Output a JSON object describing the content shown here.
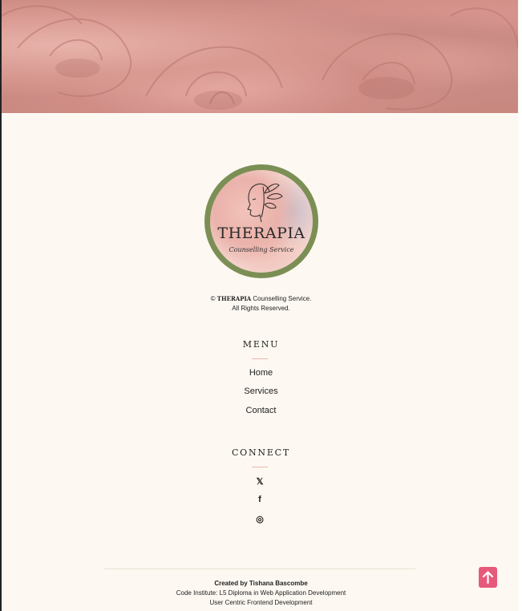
{
  "hero": {
    "image": "pink-roses-banner"
  },
  "logo": {
    "title": "THERAPIA",
    "subtitle": "Counselling Service",
    "ring_color": "#7b8f55"
  },
  "footer": {
    "copyright_symbol": "©",
    "brand": "THERAPIA",
    "copyright_text": "Counselling Service.",
    "rights": "All Rights Reserved.",
    "menu_heading": "MENU",
    "menu_items": [
      "Home",
      "Services",
      "Contact"
    ],
    "connect_heading": "CONNECT",
    "social": [
      {
        "name": "x-twitter-icon",
        "glyph": "𝕏"
      },
      {
        "name": "facebook-icon",
        "glyph": "f"
      },
      {
        "name": "instagram-icon",
        "glyph": "◎"
      }
    ],
    "credit_title": "Created by Tishana Bascombe",
    "credit_line1": "Code Institute: L5 Diploma in Web Application Development",
    "credit_line2": "User Centric Frontend Development",
    "accent_color": "#e7597b",
    "divider_color": "#e9b9ae"
  }
}
